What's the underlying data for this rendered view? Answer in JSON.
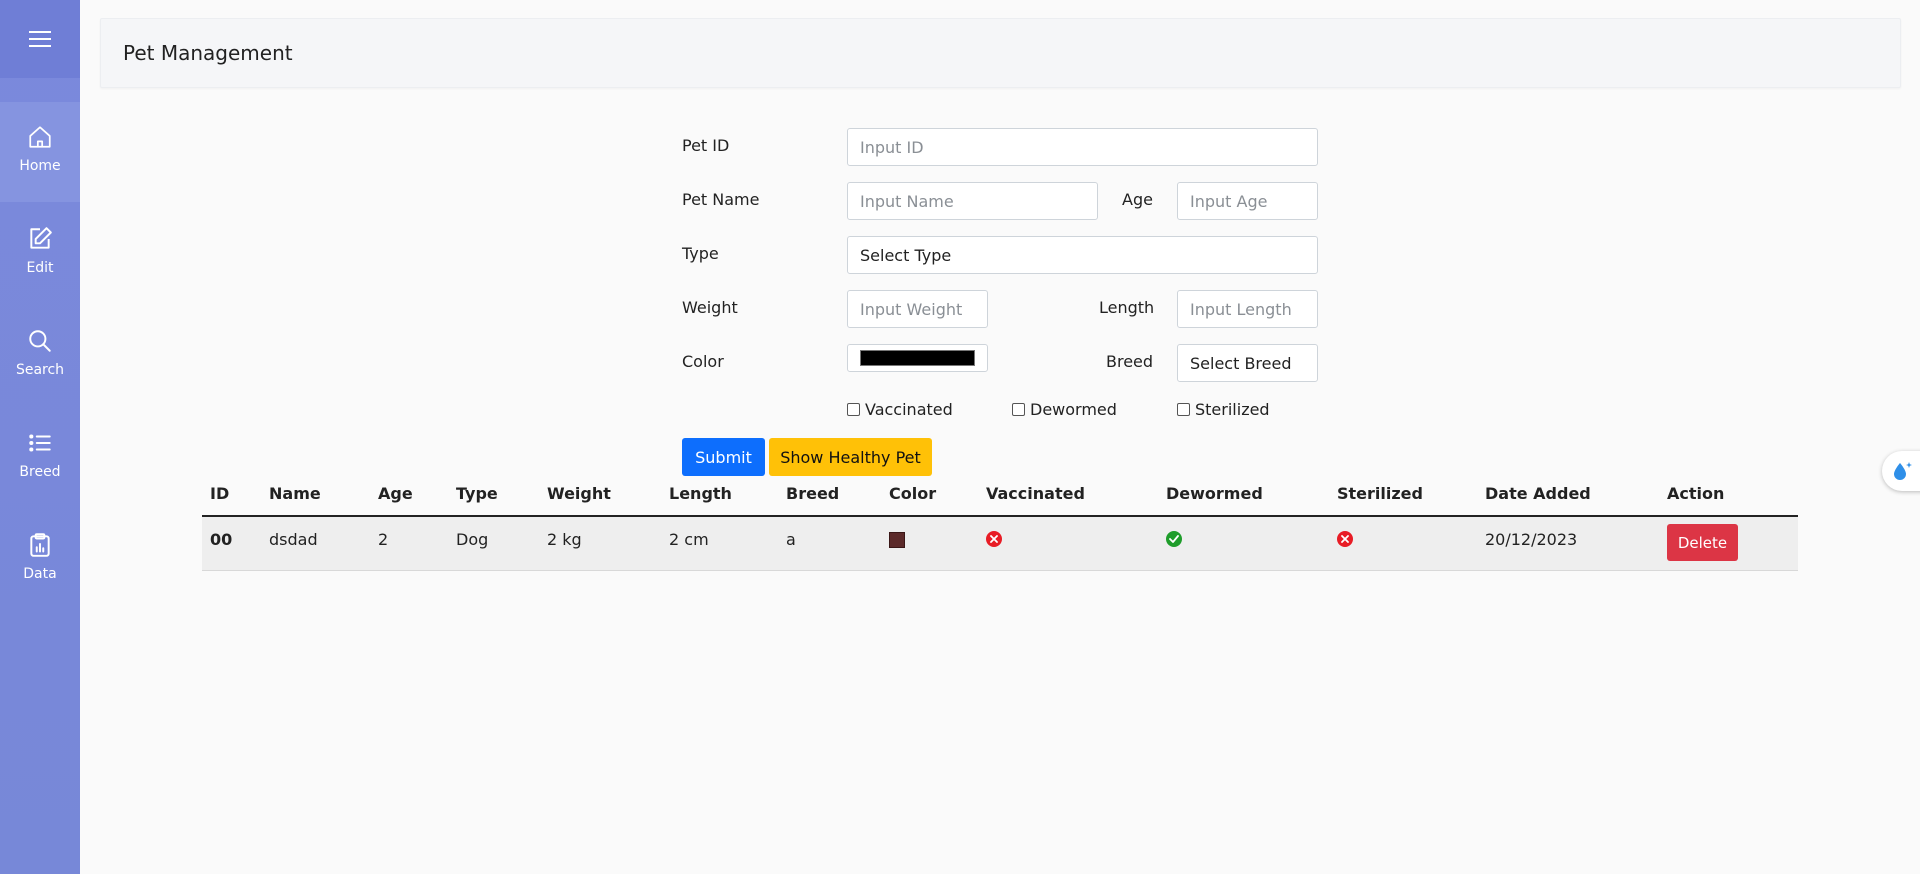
{
  "app": {
    "title": "Pet Management"
  },
  "sidebar": {
    "menu_icon": "hamburger-icon",
    "items": [
      {
        "label": "Home",
        "icon": "home-icon"
      },
      {
        "label": "Edit",
        "icon": "edit-icon"
      },
      {
        "label": "Search",
        "icon": "search-icon"
      },
      {
        "label": "Breed",
        "icon": "list-icon"
      },
      {
        "label": "Data",
        "icon": "clipboard-data-icon"
      }
    ]
  },
  "form": {
    "pet_id": {
      "label": "Pet ID",
      "placeholder": "Input ID"
    },
    "pet_name": {
      "label": "Pet Name",
      "placeholder": "Input Name"
    },
    "age": {
      "label": "Age",
      "placeholder": "Input Age"
    },
    "type": {
      "label": "Type",
      "value": "Select Type"
    },
    "weight": {
      "label": "Weight",
      "placeholder": "Input Weight"
    },
    "length": {
      "label": "Length",
      "placeholder": "Input Length"
    },
    "color": {
      "label": "Color",
      "value": "#000000"
    },
    "breed": {
      "label": "Breed",
      "value": "Select Breed"
    },
    "checkboxes": {
      "vaccinated": "Vaccinated",
      "dewormed": "Dewormed",
      "sterilized": "Sterilized"
    },
    "submit_label": "Submit",
    "healthy_label": "Show Healthy Pet"
  },
  "table": {
    "headers": [
      "ID",
      "Name",
      "Age",
      "Type",
      "Weight",
      "Length",
      "Breed",
      "Color",
      "Vaccinated",
      "Dewormed",
      "Sterilized",
      "Date Added",
      "Action"
    ],
    "rows": [
      {
        "id": "00",
        "name": "dsdad",
        "age": "2",
        "type": "Dog",
        "weight": "2 kg",
        "length": "2 cm",
        "breed": "a",
        "color": "#5c2a2a",
        "vaccinated": false,
        "dewormed": true,
        "sterilized": false,
        "date_added": "20/12/2023",
        "action_label": "Delete"
      }
    ]
  },
  "colors": {
    "sidebar": "#7b89dc",
    "primary": "#0d6efd",
    "warning": "#ffc107",
    "danger": "#dc3545",
    "success": "#1f9d2b"
  }
}
